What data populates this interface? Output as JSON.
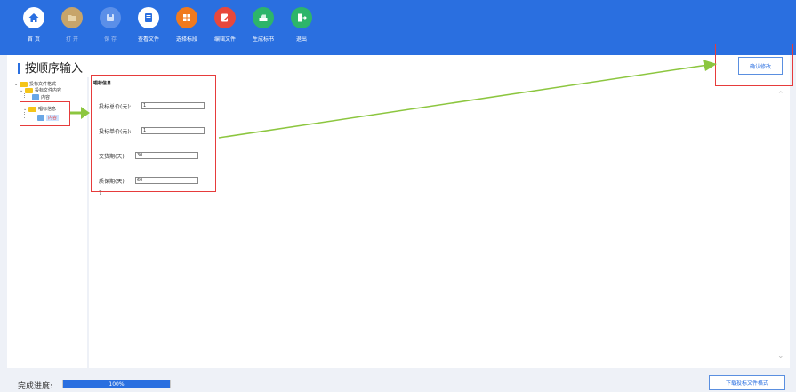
{
  "toolbar": {
    "items": [
      {
        "label": "首 页",
        "icon": "home-icon",
        "color": "#2a6fe0",
        "disabled": false
      },
      {
        "label": "打 开",
        "icon": "folder-icon",
        "color": "#c7a46a",
        "disabled": true
      },
      {
        "label": "保 存",
        "icon": "save-icon",
        "color": "#5b8fe8",
        "disabled": true
      },
      {
        "label": "查看文件",
        "icon": "file-view-icon",
        "color": "#2a6fe0",
        "disabled": false
      },
      {
        "label": "选择标段",
        "icon": "grid-icon",
        "color": "#f07a1e",
        "disabled": false
      },
      {
        "label": "编辑文件",
        "icon": "edit-file-icon",
        "color": "#e8483c",
        "disabled": false
      },
      {
        "label": "生成标书",
        "icon": "generate-icon",
        "color": "#2db56a",
        "disabled": false
      },
      {
        "label": "退出",
        "icon": "exit-icon",
        "color": "#2db56a",
        "disabled": false
      }
    ]
  },
  "header": {
    "title": "按顺序输入",
    "confirm_label": "确认修改"
  },
  "tree": {
    "nodes": [
      {
        "label": "投标文件格式"
      },
      {
        "label": "投标文件内容"
      },
      {
        "label": "内容"
      },
      {
        "label": "唱标信息"
      },
      {
        "label": "内容"
      }
    ]
  },
  "form": {
    "section_title": "唱标信息",
    "fields": [
      {
        "label": "投标总价(元):",
        "value": "1"
      },
      {
        "label": "投标单价(元):",
        "value": "1"
      },
      {
        "label": "交货期(天):",
        "value": "30"
      },
      {
        "label": "质保期(天):",
        "value": "60"
      }
    ],
    "trailing_mark": "?"
  },
  "footer": {
    "progress_label": "完成进度:",
    "progress_text": "100%",
    "progress_fraction": 1.0,
    "download_label": "下载投标文件格式"
  },
  "colors": {
    "toolbar_bg": "#2a6fe0",
    "annotation_red": "#e63b3b",
    "arrow_green": "#8cc63f"
  }
}
